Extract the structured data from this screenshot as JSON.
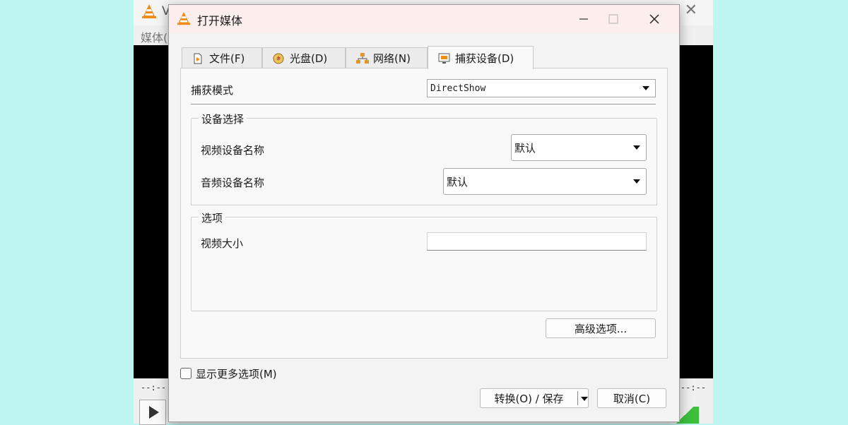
{
  "background_app": {
    "title": "V",
    "menu": "媒体(",
    "time_left": "--:--",
    "time_right": "--:--"
  },
  "dialog": {
    "title": "打开媒体",
    "tabs": [
      {
        "label": "文件(F)",
        "icon": "file-play-icon"
      },
      {
        "label": "光盘(D)",
        "icon": "disc-icon"
      },
      {
        "label": "网络(N)",
        "icon": "network-icon"
      },
      {
        "label": "捕获设备(D)",
        "icon": "capture-device-icon",
        "active": true
      }
    ],
    "capture_mode": {
      "label": "捕获模式",
      "value": "DirectShow"
    },
    "device_group": {
      "title": "设备选择",
      "video_label": "视频设备名称",
      "video_value": "默认",
      "audio_label": "音频设备名称",
      "audio_value": "默认"
    },
    "options_group": {
      "title": "选项",
      "video_size_label": "视频大小",
      "video_size_value": ""
    },
    "advanced_button": "高级选项...",
    "show_more_label": "显示更多选项(M)",
    "show_more_checked": false,
    "convert_button": "转换(O) / 保存",
    "cancel_button": "取消(C)"
  },
  "colors": {
    "page_bg": "#bff6f1",
    "title_bar": "#fbeeec",
    "vlc_orange": "#f08c1a"
  }
}
